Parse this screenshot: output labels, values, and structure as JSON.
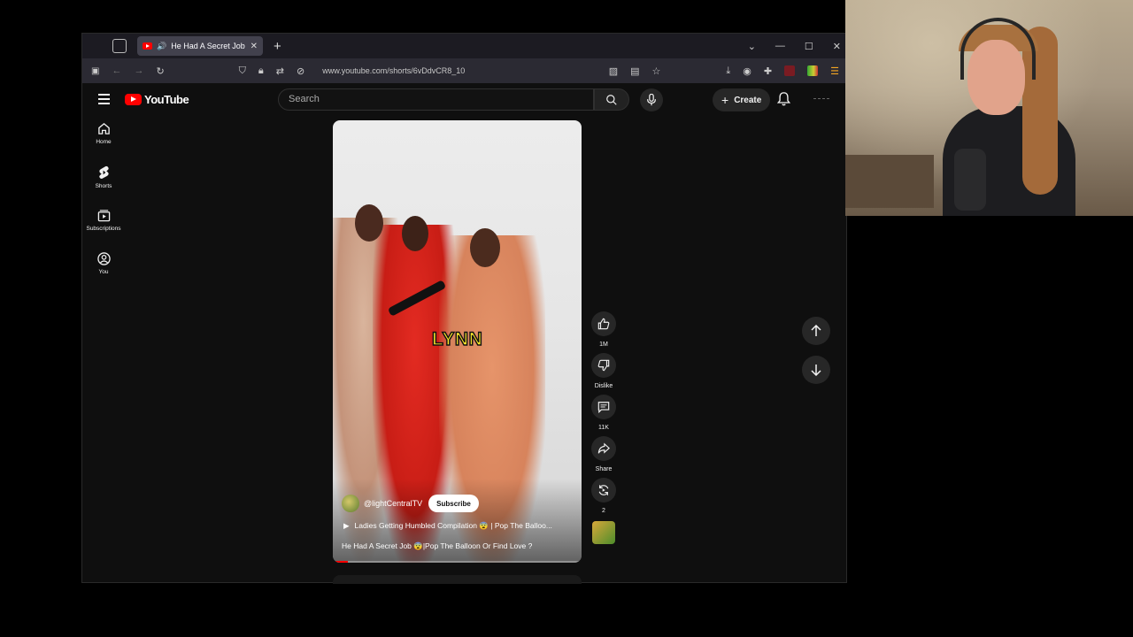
{
  "browser": {
    "tab_title": "He Had A Secret Job 😨|Pop",
    "url": "www.youtube.com/shorts/6vDdvCR8_10"
  },
  "youtube": {
    "logo_text": "YouTube",
    "search_placeholder": "Search",
    "create_label": "Create",
    "sidebar": [
      {
        "label": "Home"
      },
      {
        "label": "Shorts"
      },
      {
        "label": "Subscriptions"
      },
      {
        "label": "You"
      }
    ]
  },
  "short": {
    "caption": "LYNN",
    "channel": "@lightCentralTV",
    "subscribe_label": "Subscribe",
    "playlist": "Ladies Getting Humbled Compilation 😨 | Pop The Balloo...",
    "title": "He Had A Secret Job 😨|Pop The Balloon Or Find Love ?",
    "progress": 0.06,
    "actions": {
      "like_count": "1M",
      "dislike_label": "Dislike",
      "comments_count": "11K",
      "share_label": "Share",
      "remix_count": "2"
    }
  },
  "colors": {
    "accent": "#ff0000",
    "background": "#0f0f0f",
    "caption_text": "#ffeb2a"
  }
}
